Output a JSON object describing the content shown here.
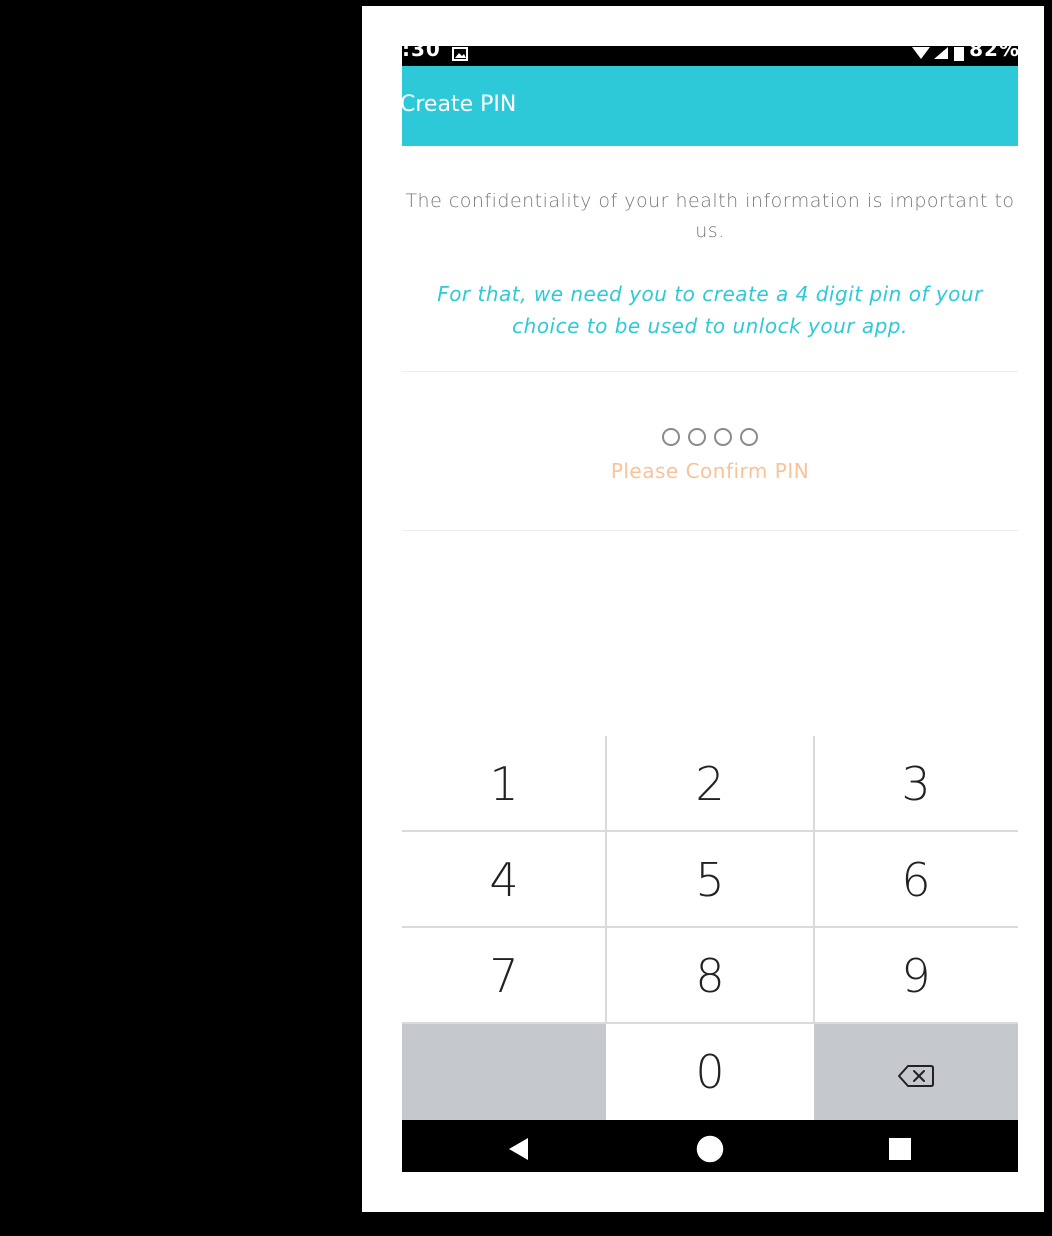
{
  "status_bar": {
    "time": ":30",
    "battery_percent": "82%",
    "icons": [
      "image-icon",
      "wifi-icon",
      "signal-icon",
      "battery-icon"
    ]
  },
  "app_bar": {
    "title": "Create PIN",
    "color": "#2ec9d8"
  },
  "intro": {
    "confidentiality": "The confidentiality of your health information is important to us.",
    "instruction": "For that, we need you to create a 4 digit pin of your choice to be used to unlock your app."
  },
  "pin": {
    "length": 4,
    "entered": 0,
    "prompt": "Please Confirm PIN",
    "prompt_color": "#f9c39a"
  },
  "keypad": {
    "keys": [
      "1",
      "2",
      "3",
      "4",
      "5",
      "6",
      "7",
      "8",
      "9",
      "",
      "0",
      "backspace-icon"
    ],
    "key_labels": {
      "k1": "1",
      "k2": "2",
      "k3": "3",
      "k4": "4",
      "k5": "5",
      "k6": "6",
      "k7": "7",
      "k8": "8",
      "k9": "9",
      "k0": "0"
    }
  },
  "nav_bar": {
    "icons": [
      "back-icon",
      "home-icon",
      "recents-icon"
    ]
  }
}
